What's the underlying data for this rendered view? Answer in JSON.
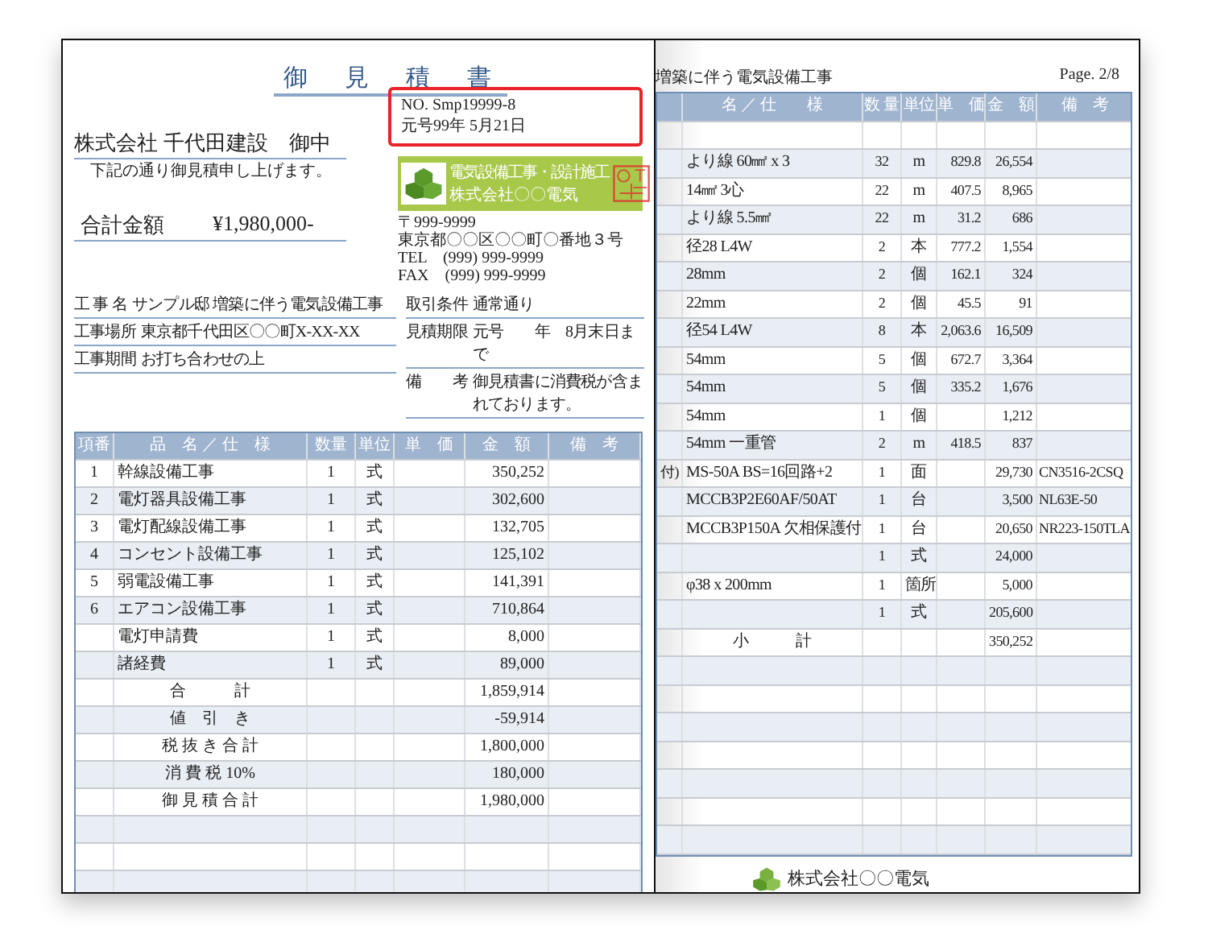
{
  "left_page": {
    "title": "御　見　積　書",
    "quote_no": "NO.  Smp19999-8",
    "date": "元号99年  5月21日",
    "recipient": "株式会社 千代田建設　御中",
    "greeting": "下記の通り御見積申し上げます。",
    "total_label": "合計金額",
    "total_amount": "¥1,980,000-",
    "company": {
      "tagline": "電気設備工事・設計施工",
      "name": "株式会社〇〇電気",
      "postal": "〒999-9999",
      "address": "東京都〇〇区〇〇町〇番地３号",
      "tel": "TEL　(999) 999-9999",
      "fax": "FAX　(999) 999-9999"
    },
    "info_left": [
      {
        "label": "工 事 名",
        "value": "サンプル邸 増築に伴う電気設備工事"
      },
      {
        "label": "工事場所",
        "value": "東京都千代田区〇〇町X-XX-XX"
      },
      {
        "label": "工事期間",
        "value": "お打ち合わせの上"
      }
    ],
    "info_right": [
      {
        "label": "取引条件",
        "value": "通常通り"
      },
      {
        "label": "見積期限",
        "value": "元号　　年　8月末日まで"
      },
      {
        "label": "備　　考",
        "value": "御見積書に消費税が含まれております。"
      }
    ],
    "table": {
      "columns": [
        "項番",
        "品　名 ／ 仕　様",
        "数量",
        "単位",
        "単　価",
        "金　額",
        "備　考"
      ],
      "rows": [
        {
          "kind": "item",
          "cells": [
            "1",
            "幹線設備工事",
            "1",
            "式",
            "",
            "350,252",
            ""
          ]
        },
        {
          "kind": "item",
          "cells": [
            "2",
            "電灯器具設備工事",
            "1",
            "式",
            "",
            "302,600",
            ""
          ]
        },
        {
          "kind": "item",
          "cells": [
            "3",
            "電灯配線設備工事",
            "1",
            "式",
            "",
            "132,705",
            ""
          ]
        },
        {
          "kind": "item",
          "cells": [
            "4",
            "コンセント設備工事",
            "1",
            "式",
            "",
            "125,102",
            ""
          ]
        },
        {
          "kind": "item",
          "cells": [
            "5",
            "弱電設備工事",
            "1",
            "式",
            "",
            "141,391",
            ""
          ]
        },
        {
          "kind": "item",
          "cells": [
            "6",
            "エアコン設備工事",
            "1",
            "式",
            "",
            "710,864",
            ""
          ]
        },
        {
          "kind": "item",
          "cells": [
            "",
            "電灯申請費",
            "1",
            "式",
            "",
            "8,000",
            ""
          ]
        },
        {
          "kind": "item",
          "cells": [
            "",
            "諸経費",
            "1",
            "式",
            "",
            "89,000",
            ""
          ]
        },
        {
          "kind": "total",
          "cells": [
            "",
            "合　　　計",
            "",
            "",
            "",
            "1,859,914",
            ""
          ]
        },
        {
          "kind": "total",
          "cells": [
            "",
            "値　引　き",
            "",
            "",
            "",
            "-59,914",
            ""
          ]
        },
        {
          "kind": "total",
          "cells": [
            "",
            "税 抜 き 合 計",
            "",
            "",
            "",
            "1,800,000",
            ""
          ]
        },
        {
          "kind": "total",
          "cells": [
            "",
            "消 費 税  10%",
            "",
            "",
            "",
            "180,000",
            ""
          ]
        },
        {
          "kind": "total",
          "cells": [
            "",
            "御 見 積 合 計",
            "",
            "",
            "",
            "1,980,000",
            ""
          ]
        }
      ]
    }
  },
  "right_page": {
    "title": "増築に伴う電気設備工事",
    "page": "Page.  2/8",
    "table": {
      "columns": [
        "",
        "名 ／ 仕　　様",
        "数 量",
        "単位",
        "単　価",
        "金　額",
        "備　考"
      ],
      "rows": [
        {
          "kind": "blank",
          "cells": []
        },
        {
          "kind": "item",
          "cells": [
            "",
            "より線 60㎟ x 3",
            "32",
            "m",
            "829.8",
            "26,554",
            ""
          ]
        },
        {
          "kind": "item",
          "cells": [
            "",
            "14㎟ 3心",
            "22",
            "m",
            "407.5",
            "8,965",
            ""
          ]
        },
        {
          "kind": "item",
          "cells": [
            "",
            "より線 5.5㎟",
            "22",
            "m",
            "31.2",
            "686",
            ""
          ]
        },
        {
          "kind": "item",
          "cells": [
            "",
            "径28 L4W",
            "2",
            "本",
            "777.2",
            "1,554",
            ""
          ]
        },
        {
          "kind": "item",
          "cells": [
            "",
            "28mm",
            "2",
            "個",
            "162.1",
            "324",
            ""
          ]
        },
        {
          "kind": "item",
          "cells": [
            "",
            "22mm",
            "2",
            "個",
            "45.5",
            "91",
            ""
          ]
        },
        {
          "kind": "item",
          "cells": [
            "",
            "径54 L4W",
            "8",
            "本",
            "2,063.6",
            "16,509",
            ""
          ]
        },
        {
          "kind": "item",
          "cells": [
            "",
            "54mm",
            "5",
            "個",
            "672.7",
            "3,364",
            ""
          ]
        },
        {
          "kind": "item",
          "cells": [
            "",
            "54mm",
            "5",
            "個",
            "335.2",
            "1,676",
            ""
          ]
        },
        {
          "kind": "item",
          "cells": [
            "",
            "54mm",
            "1",
            "個",
            "",
            "1,212",
            ""
          ]
        },
        {
          "kind": "item",
          "cells": [
            "",
            "54mm 一重管",
            "2",
            "m",
            "418.5",
            "837",
            ""
          ]
        },
        {
          "kind": "item",
          "cells": [
            "付)",
            "MS-50A BS=16回路+2",
            "1",
            "面",
            "",
            "29,730",
            "CN3516-2CSQ"
          ]
        },
        {
          "kind": "item",
          "cells": [
            "",
            "MCCB3P2E60AF/50AT",
            "1",
            "台",
            "",
            "3,500",
            "NL63E-50"
          ]
        },
        {
          "kind": "item",
          "cells": [
            "",
            "MCCB3P150A 欠相保護付",
            "1",
            "台",
            "",
            "20,650",
            "NR223-150TLA"
          ]
        },
        {
          "kind": "item",
          "cells": [
            "",
            "",
            "1",
            "式",
            "",
            "24,000",
            ""
          ]
        },
        {
          "kind": "item",
          "cells": [
            "",
            "φ38 x 200mm",
            "1",
            "箇所",
            "",
            "5,000",
            ""
          ]
        },
        {
          "kind": "item",
          "cells": [
            "",
            "",
            "1",
            "式",
            "",
            "205,600",
            ""
          ]
        },
        {
          "kind": "total",
          "cells": [
            "",
            "小　　　計",
            "",
            "",
            "",
            "350,252",
            ""
          ]
        }
      ]
    },
    "footer": "株式会社〇〇電気"
  }
}
